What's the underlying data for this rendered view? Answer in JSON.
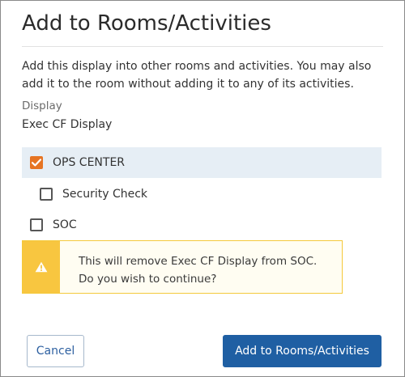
{
  "dialog": {
    "title": "Add to Rooms/Activities",
    "intro_line1": "Add this display into other rooms and activities. You may also",
    "intro_line2": "add it to the room without adding it to any of its activities.",
    "display_label": "Display",
    "display_value": "Exec CF Display"
  },
  "items": [
    {
      "label": "OPS CENTER",
      "checked": true,
      "selected": true,
      "icon": "checkbox-checked-icon"
    },
    {
      "label": "Security Check",
      "checked": false,
      "icon": "checkbox-icon"
    },
    {
      "label": "SOC",
      "checked": false,
      "icon": "checkbox-icon"
    }
  ],
  "warning": {
    "icon": "warning-triangle-icon",
    "line1": "This will remove Exec CF Display from SOC.",
    "line2": "Do you wish to continue?"
  },
  "buttons": {
    "cancel": "Cancel",
    "submit": "Add to Rooms/Activities"
  },
  "colors": {
    "checkbox_checked": "#e67423",
    "selected_row_bg": "#e6eef5",
    "warning_accent": "#f8c640",
    "warning_border": "#f4c93b",
    "primary_button": "#1f5fa3",
    "cancel_text": "#2c5fa0"
  }
}
